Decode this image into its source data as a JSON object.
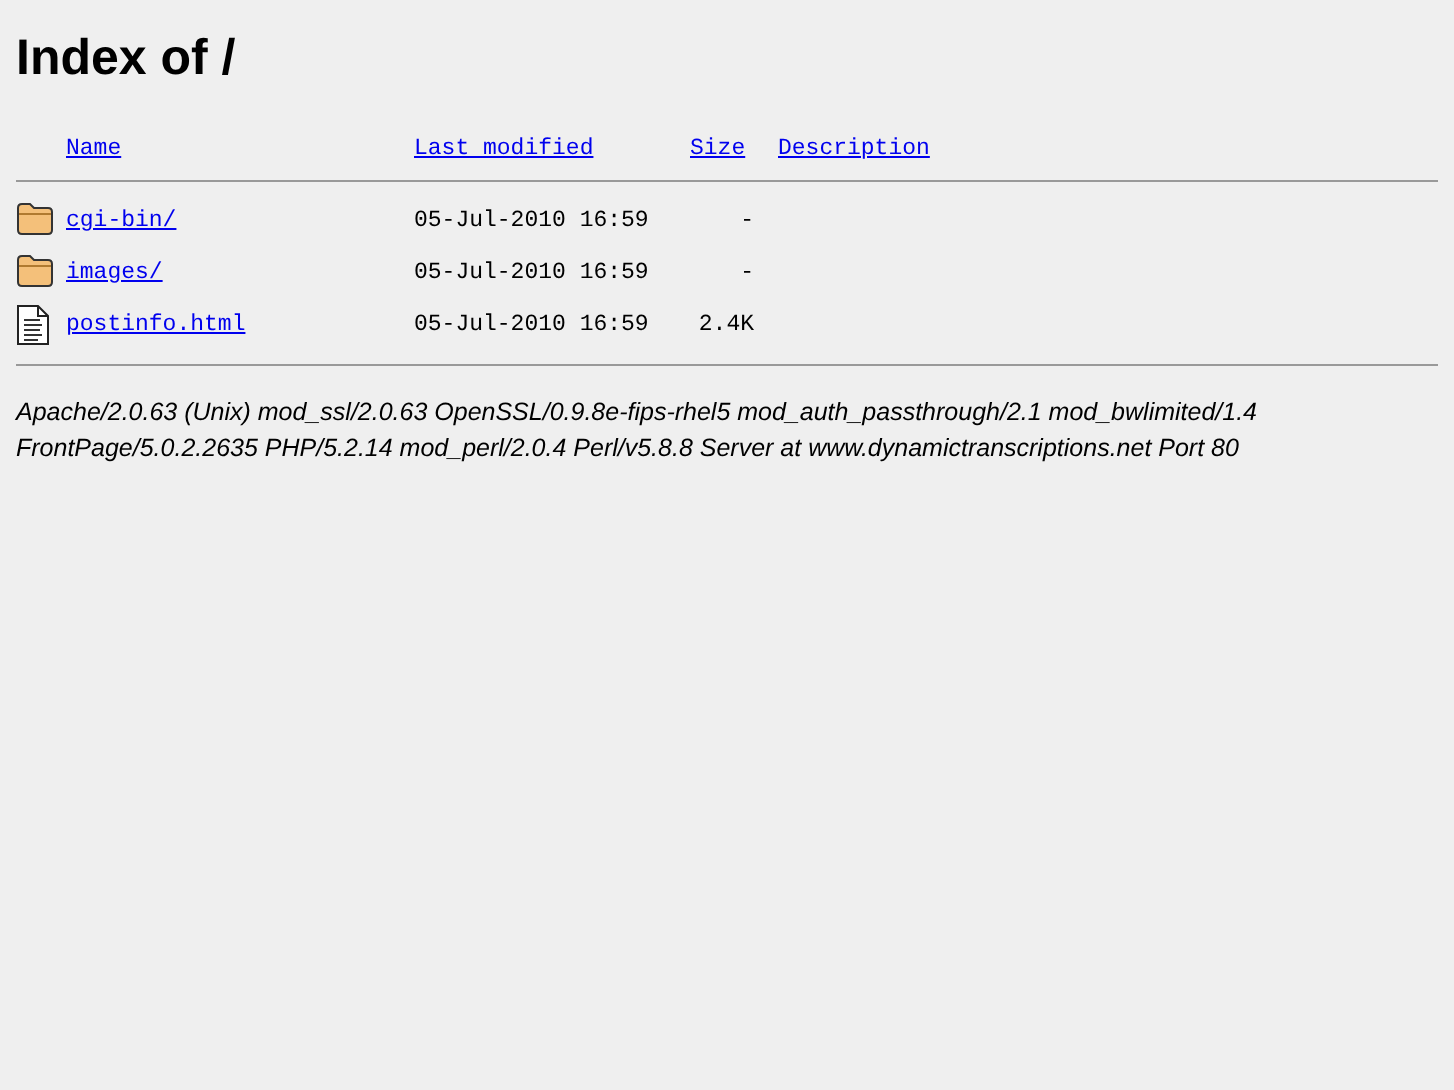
{
  "title": "Index of /",
  "columns": [
    "Name",
    "Last modified",
    "Size",
    "Description"
  ],
  "rows": [
    {
      "kind": "folder",
      "name": "cgi-bin/",
      "modified": "05-Jul-2010 16:59",
      "size": "-"
    },
    {
      "kind": "folder",
      "name": "images/",
      "modified": "05-Jul-2010 16:59",
      "size": "-"
    },
    {
      "kind": "file",
      "name": "postinfo.html",
      "modified": "05-Jul-2010 16:59",
      "size": "2.4K"
    }
  ],
  "address": "Apache/2.0.63 (Unix) mod_ssl/2.0.63 OpenSSL/0.9.8e-fips-rhel5 mod_auth_passthrough/2.1 mod_bwlimited/1.4 FrontPage/5.0.2.2635 PHP/5.2.14 mod_perl/2.0.4 Perl/v5.8.8 Server at www.dynamictranscriptions.net Port 80"
}
